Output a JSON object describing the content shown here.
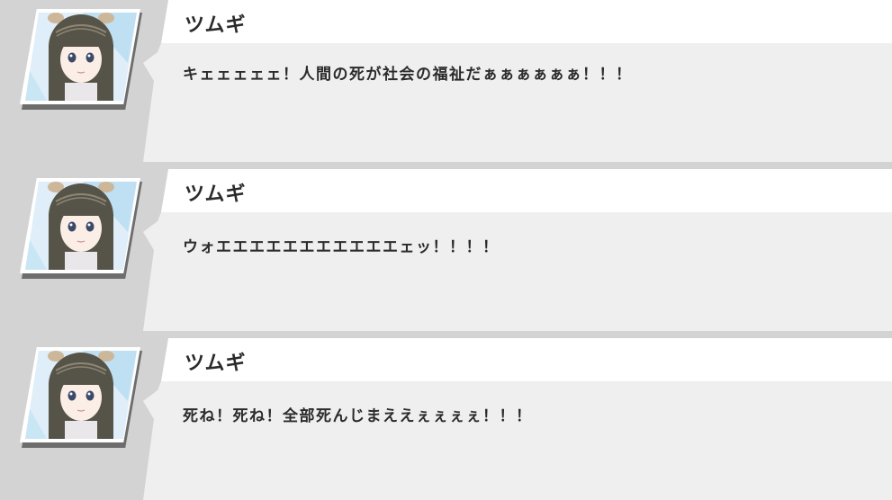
{
  "messages": [
    {
      "speaker": "ツムギ",
      "text": "キェェェェェ！人間の死が社会の福祉だぁぁぁぁぁぁ！！！",
      "avatar_icon": "character-avatar-icon"
    },
    {
      "speaker": "ツムギ",
      "text": "ウォエエエエエエエエエエエェッ！！！！",
      "avatar_icon": "character-avatar-icon"
    },
    {
      "speaker": "ツムギ",
      "text": "死ね！死ね！全部死んじまええぇぇぇぇ！！！",
      "avatar_icon": "character-avatar-icon"
    }
  ],
  "colors": {
    "background": "#d3d3d3",
    "name_tab": "#ffffff",
    "message_body": "#efefef",
    "text": "#2b2b2b"
  }
}
